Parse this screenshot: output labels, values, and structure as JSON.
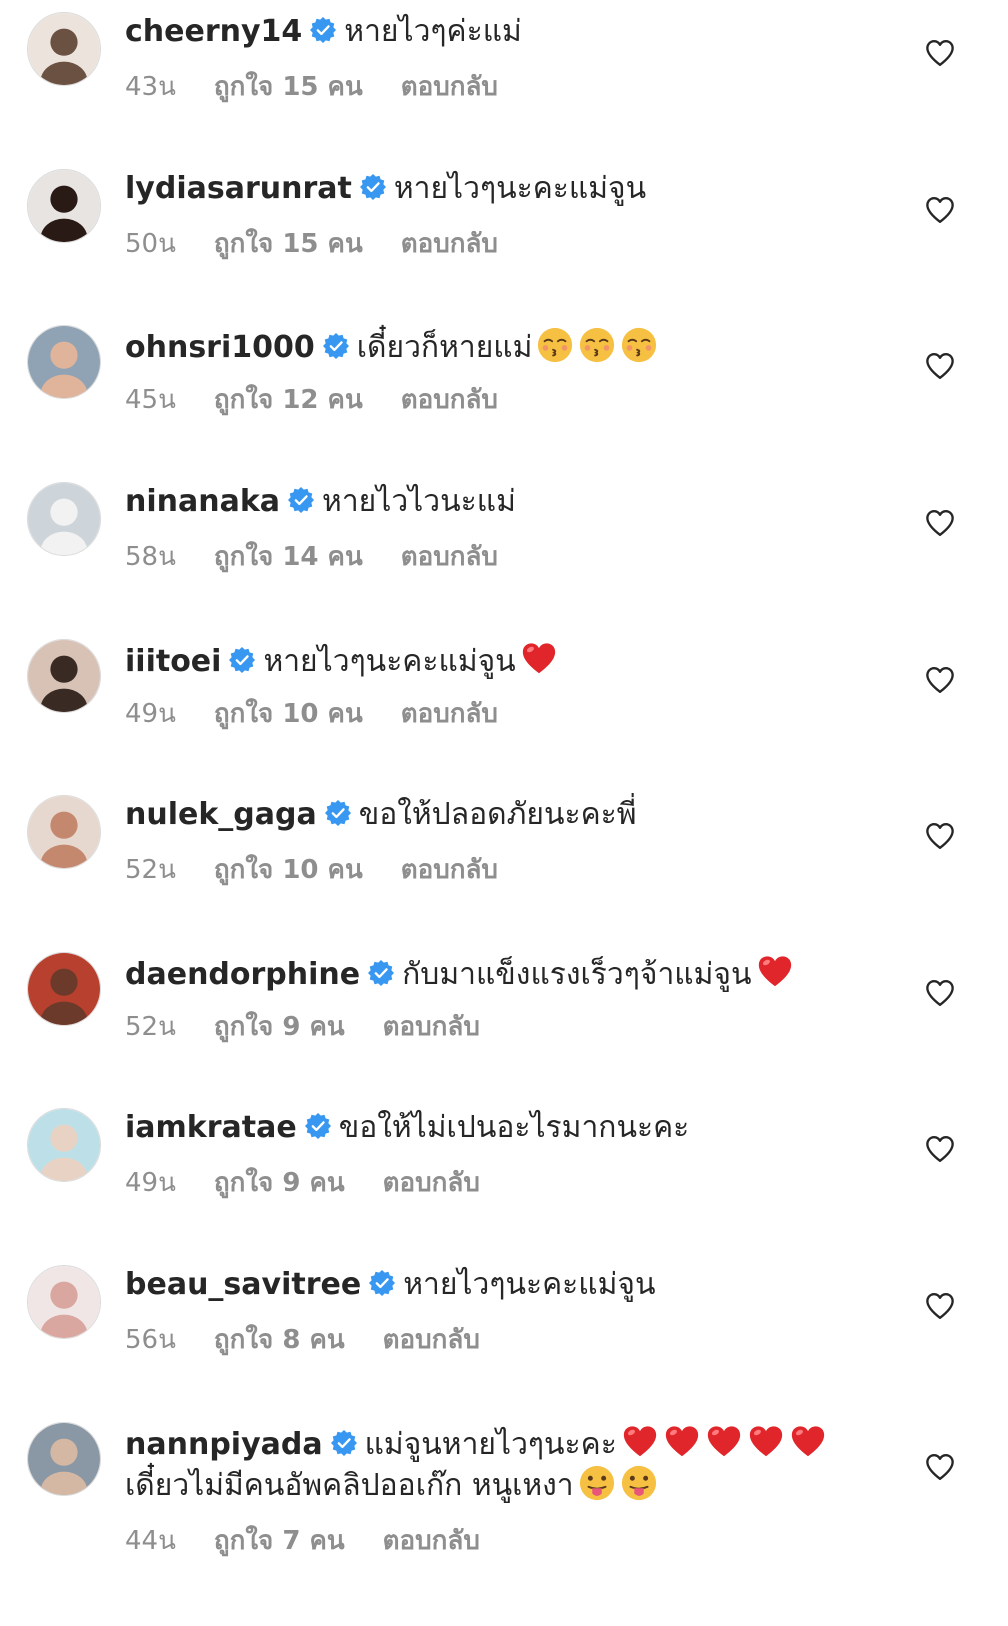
{
  "comments": [
    {
      "username": "cheerny14",
      "text": "หายไวๆค่ะแม่",
      "time": "43น",
      "likes": "ถูกใจ 15 คน",
      "reply": "ตอบกลับ",
      "emojis": [],
      "avatar_colors": [
        "#ece4dc",
        "#6b5142"
      ]
    },
    {
      "username": "lydiasarunrat",
      "text": "หายไวๆนะคะแม่จูน",
      "time": "50น",
      "likes": "ถูกใจ 15 คน",
      "reply": "ตอบกลับ",
      "emojis": [],
      "avatar_colors": [
        "#e8e4e2",
        "#2a1a16"
      ]
    },
    {
      "username": "ohnsri1000",
      "text": "เดี๋ยวก็หายแม่",
      "time": "45น",
      "likes": "ถูกใจ 12 คน",
      "reply": "ตอบกลับ",
      "emojis": [
        "kissing-face",
        "kissing-face",
        "kissing-face"
      ],
      "avatar_colors": [
        "#8fa3b4",
        "#e0b49a"
      ]
    },
    {
      "username": "ninanaka",
      "text": "หายไวไวนะแม่",
      "time": "58น",
      "likes": "ถูกใจ 14 คน",
      "reply": "ตอบกลับ",
      "emojis": [],
      "avatar_colors": [
        "#cdd5da",
        "#f2f2f2"
      ]
    },
    {
      "username": "iiitoei",
      "text": "หายไวๆนะคะแม่จูน",
      "time": "49น",
      "likes": "ถูกใจ 10 คน",
      "reply": "ตอบกลับ",
      "emojis": [
        "red-heart"
      ],
      "avatar_colors": [
        "#d8c2b5",
        "#3a2a24"
      ]
    },
    {
      "username": "nulek_gaga",
      "text": "ขอให้ปลอดภัยนะคะพี่",
      "time": "52น",
      "likes": "ถูกใจ 10 คน",
      "reply": "ตอบกลับ",
      "emojis": [],
      "avatar_colors": [
        "#e6d8cf",
        "#c4886e"
      ]
    },
    {
      "username": "daendorphine",
      "text": "กับมาแข็งแรงเร็วๆจ้าแม่จูน",
      "time": "52น",
      "likes": "ถูกใจ 9 คน",
      "reply": "ตอบกลับ",
      "emojis": [
        "red-heart"
      ],
      "avatar_colors": [
        "#b8402e",
        "#6b3a2a"
      ]
    },
    {
      "username": "iamkratae",
      "text": "ขอให้ไม่เปนอะไรมากนะคะ",
      "time": "49น",
      "likes": "ถูกใจ 9 คน",
      "reply": "ตอบกลับ",
      "emojis": [],
      "avatar_colors": [
        "#bde0e8",
        "#e8d2c4"
      ]
    },
    {
      "username": "beau_savitree",
      "text": "หายไวๆนะคะแม่จูน",
      "time": "56น",
      "likes": "ถูกใจ 8 คน",
      "reply": "ตอบกลับ",
      "emojis": [],
      "avatar_colors": [
        "#f0e6e6",
        "#d9a7a0"
      ]
    },
    {
      "username": "nannpiyada",
      "text": "แม่จูนหายไวๆนะคะ",
      "text2": "เดี๋ยวไม่มีคนอัพคลิปออเก๊ก หนูเหงา",
      "time": "44น",
      "likes": "ถูกใจ 7 คน",
      "reply": "ตอบกลับ",
      "emojis": [
        "red-heart",
        "red-heart",
        "red-heart",
        "red-heart",
        "red-heart"
      ],
      "emojis2": [
        "face-with-tongue",
        "face-with-tongue"
      ],
      "avatar_colors": [
        "#8a98a6",
        "#d4b8a4"
      ]
    }
  ],
  "colors": {
    "text": "#262626",
    "meta": "#8e8e8e",
    "verified": "#3897f0",
    "heart_outline": "#262626",
    "red_heart": "#e0262a",
    "emoji_yellow": "#f6c043"
  }
}
